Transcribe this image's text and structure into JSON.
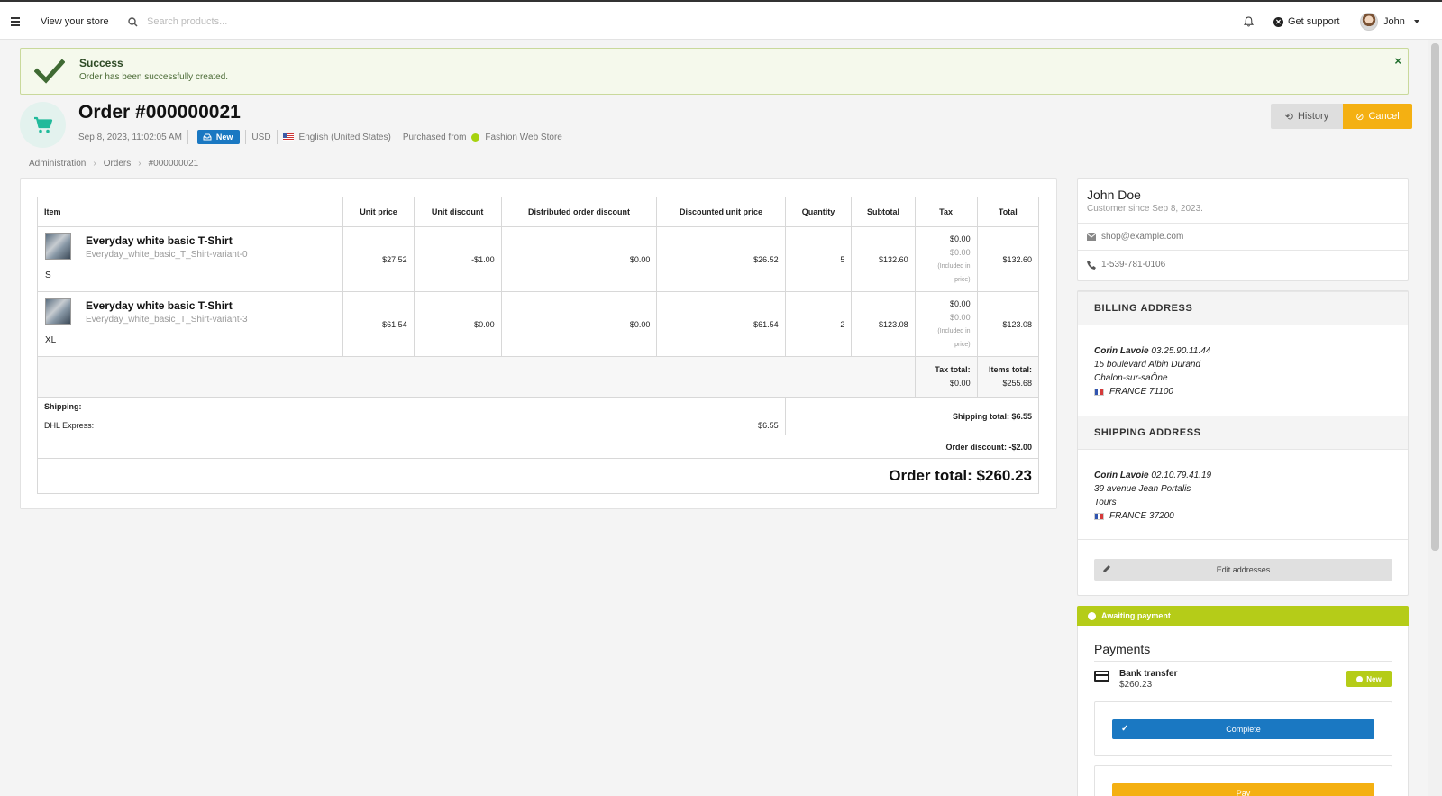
{
  "topbar": {
    "view_store": "View your store",
    "search_placeholder": "Search products...",
    "support": "Get support",
    "user": "John"
  },
  "alert": {
    "title": "Success",
    "message": "Order has been successfully created.",
    "close": "×"
  },
  "order": {
    "title": "Order #000000021",
    "date": "Sep 8, 2023, 11:02:05 AM",
    "status": "New",
    "currency": "USD",
    "locale": "English (United States)",
    "purchased_from_label": "Purchased from",
    "channel": "Fashion Web Store",
    "history_label": "History",
    "cancel_label": "Cancel"
  },
  "breadcrumb": [
    "Administration",
    "Orders",
    "#000000021"
  ],
  "table": {
    "headers": [
      "Item",
      "Unit price",
      "Unit discount",
      "Distributed order discount",
      "Discounted unit price",
      "Quantity",
      "Subtotal",
      "Tax",
      "Total"
    ],
    "rows": [
      {
        "name": "Everyday white basic T-Shirt",
        "variant": "Everyday_white_basic_T_Shirt-variant-0",
        "size": "S",
        "unit_price": "$27.52",
        "unit_discount": "-$1.00",
        "distributed_discount": "$0.00",
        "discounted_unit_price": "$26.52",
        "quantity": "5",
        "subtotal": "$132.60",
        "tax": "$0.00",
        "tax_included": "$0.00",
        "tax_note_1": "(Included in",
        "tax_note_2": "price)",
        "total": "$132.60"
      },
      {
        "name": "Everyday white basic T-Shirt",
        "variant": "Everyday_white_basic_T_Shirt-variant-3",
        "size": "XL",
        "unit_price": "$61.54",
        "unit_discount": "$0.00",
        "distributed_discount": "$0.00",
        "discounted_unit_price": "$61.54",
        "quantity": "2",
        "subtotal": "$123.08",
        "tax": "$0.00",
        "tax_included": "$0.00",
        "tax_note_1": "(Included in",
        "tax_note_2": "price)",
        "total": "$123.08"
      }
    ],
    "tax_total_label": "Tax total:",
    "tax_total": "$0.00",
    "items_total_label": "Items total:",
    "items_total": "$255.68",
    "shipping_label": "Shipping:",
    "shipping_method": "DHL Express:",
    "shipping_amount": "$6.55",
    "shipping_total": "Shipping total: $6.55",
    "order_discount": "Order discount: -$2.00",
    "order_total": "Order total: $260.23"
  },
  "customer": {
    "name": "John Doe",
    "since": "Customer since Sep 8, 2023.",
    "email": "shop@example.com",
    "phone": "1-539-781-0106"
  },
  "billing": {
    "title": "BILLING ADDRESS",
    "name": "Corin Lavoie",
    "phone": "03.25.90.11.44",
    "street": "15 boulevard Albin Durand",
    "city": "Chalon-sur-saÔne",
    "country": "FRANCE 71100"
  },
  "shipping_address": {
    "title": "SHIPPING ADDRESS",
    "name": "Corin Lavoie",
    "phone": "02.10.79.41.19",
    "street": "39 avenue Jean Portalis",
    "city": "Tours",
    "country": "FRANCE 37200"
  },
  "edit_addresses": "Edit addresses",
  "payment": {
    "state": "Awaiting payment",
    "title": "Payments",
    "method": "Bank transfer",
    "amount": "$260.23",
    "badge": "New",
    "complete": "Complete",
    "pay": "Pay"
  },
  "colors": {
    "primary": "#1a78c2",
    "warning": "#f4b012",
    "lime": "#b5cc18",
    "teal": "#21ba9b"
  }
}
